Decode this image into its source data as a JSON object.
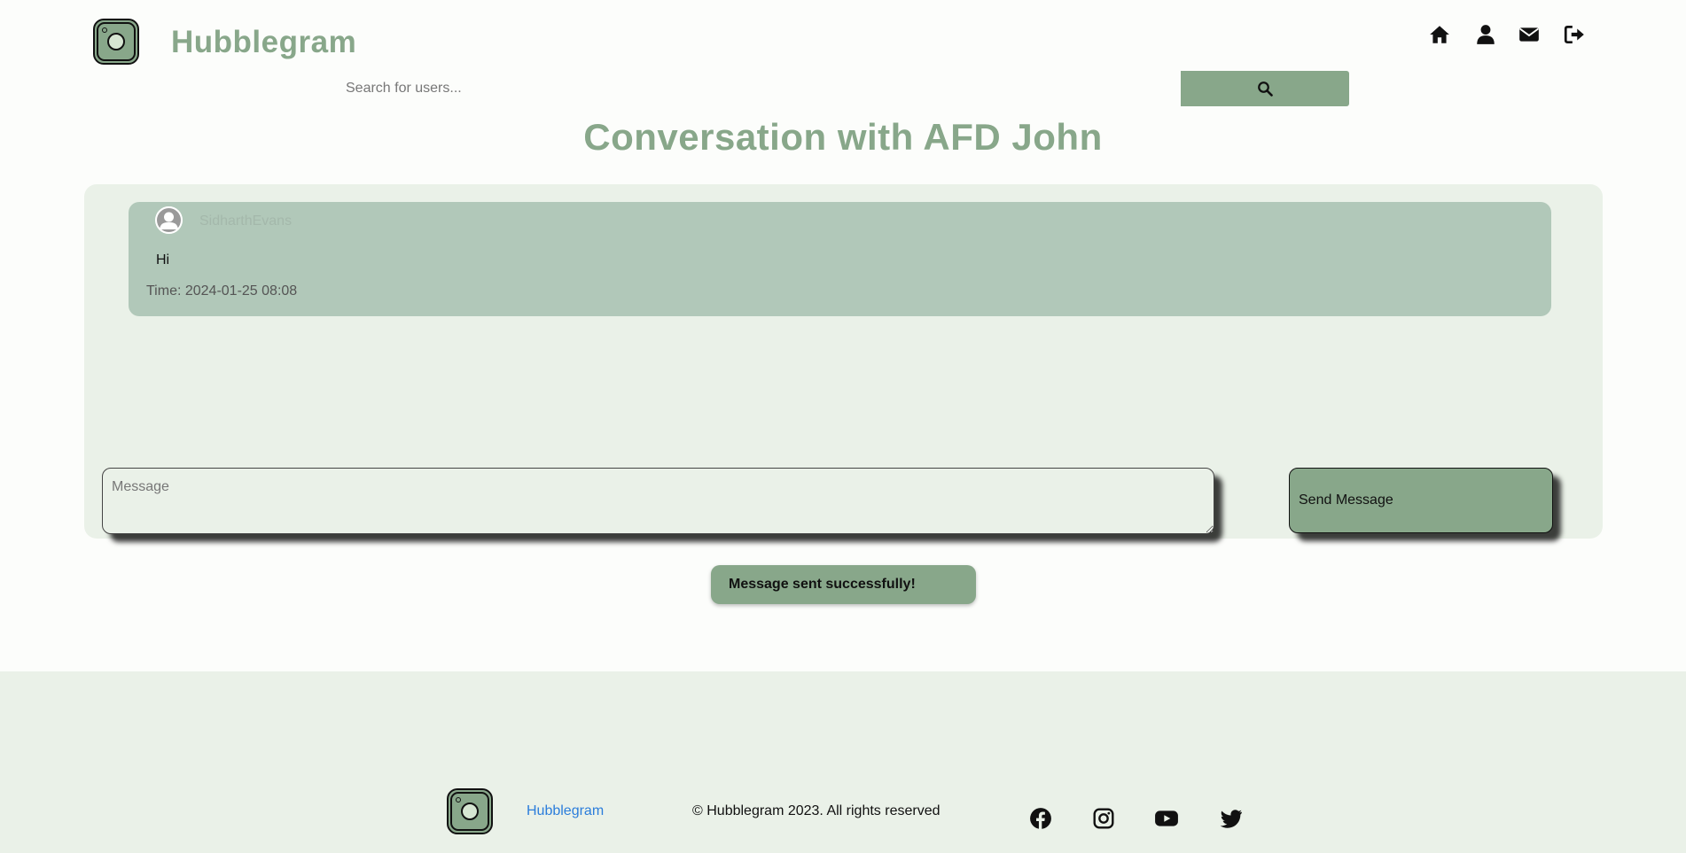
{
  "header": {
    "brand": "Hubblegram",
    "nav_icons": [
      "home-icon",
      "user-icon",
      "envelope-icon",
      "sign-out-icon"
    ]
  },
  "search": {
    "placeholder": "Search for users...",
    "button_icon": "search-icon"
  },
  "page": {
    "title": "Conversation with AFD John"
  },
  "messages": [
    {
      "sender": "SidharthEvans",
      "text": "Hi",
      "time_label": "Time:",
      "time": "2024-01-25 08:08"
    }
  ],
  "composer": {
    "placeholder": "Message",
    "send_label": "Send Message"
  },
  "toast": {
    "text": "Message sent successfully!"
  },
  "footer": {
    "brand": "Hubblegram",
    "copyright": "© Hubblegram 2023. All rights reserved",
    "social_icons": [
      "facebook-icon",
      "instagram-icon",
      "youtube-icon",
      "twitter-icon"
    ]
  },
  "colors": {
    "accent": "#88a78a",
    "panel": "#eaf1e8",
    "message_card": "#b1c8b9",
    "background": "#fcfdfb",
    "link": "#2b7ddb"
  }
}
